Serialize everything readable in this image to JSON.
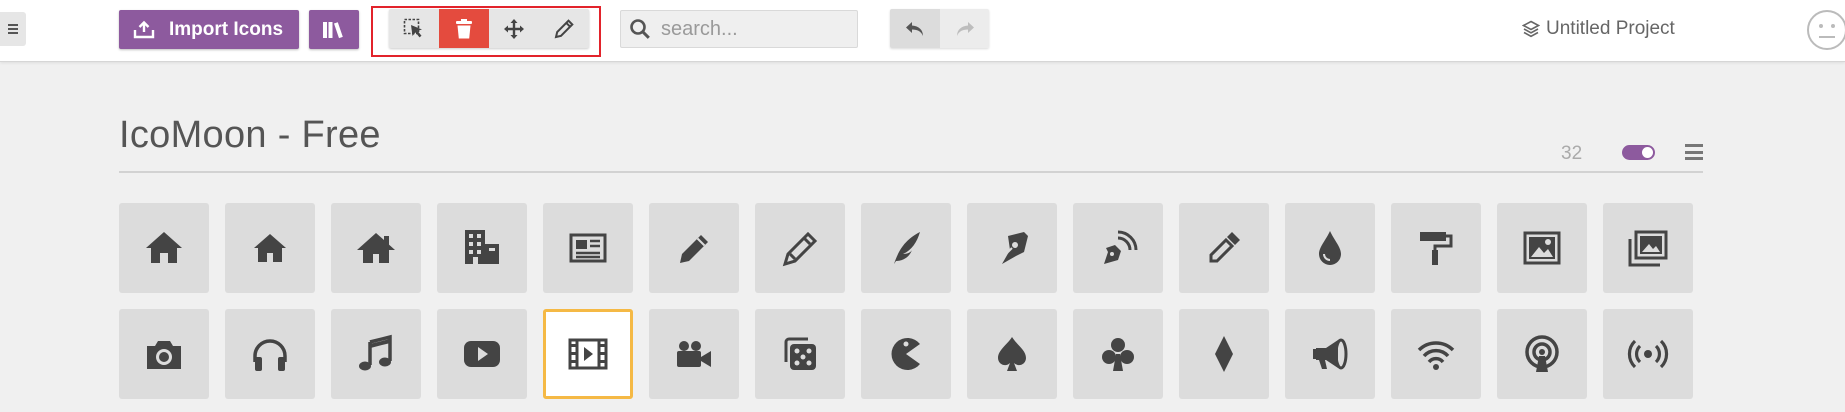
{
  "toolbar": {
    "import_label": "Import Icons",
    "search_placeholder": "search...",
    "project_name": "Untitled Project",
    "tools": [
      "select-tool",
      "delete-tool",
      "move-tool",
      "edit-tool"
    ],
    "active_tool": "delete-tool"
  },
  "set": {
    "title": "IcoMoon - Free",
    "count": "32",
    "toggle_on": true
  },
  "icons": [
    [
      "home-icon",
      "home2-icon",
      "home3-icon",
      "office-icon",
      "newspaper-icon",
      "pencil-icon",
      "pencil2-icon",
      "quill-icon",
      "pen-icon",
      "blog-icon",
      "eyedropper-icon",
      "droplet-icon",
      "paint-format-icon",
      "image-icon",
      "images-icon"
    ],
    [
      "camera-icon",
      "headphones-icon",
      "music-icon",
      "play-icon",
      "film-icon",
      "video-camera-icon",
      "dice-icon",
      "pacman-icon",
      "spades-icon",
      "clubs-icon",
      "diamonds-icon",
      "bullhorn-icon",
      "connection-icon",
      "podcast-icon",
      "feed-icon"
    ]
  ],
  "selected_icon": "film-icon",
  "colors": {
    "accent": "#8d5a9e",
    "delete": "#e44b3e",
    "highlight_frame": "#e2232b",
    "selected_border": "#f5b945",
    "icon": "#444444"
  }
}
